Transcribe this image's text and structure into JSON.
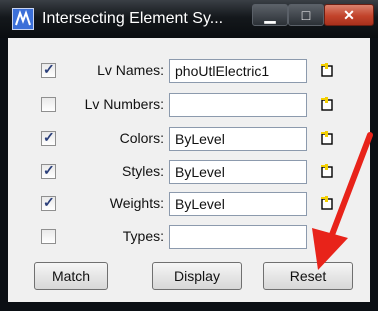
{
  "window": {
    "title": "Intersecting Element Sy...",
    "controls": {
      "minimize": "▁",
      "maximize": "□",
      "close": "✕"
    }
  },
  "rows": [
    {
      "label": "Lv Names:",
      "checked": true,
      "value": "phoUtlElectric1"
    },
    {
      "label": "Lv Numbers:",
      "checked": false,
      "value": ""
    },
    {
      "label": "Colors:",
      "checked": true,
      "value": "ByLevel"
    },
    {
      "label": "Styles:",
      "checked": true,
      "value": "ByLevel"
    },
    {
      "label": "Weights:",
      "checked": true,
      "value": "ByLevel"
    },
    {
      "label": "Types:",
      "checked": false,
      "value": ""
    }
  ],
  "check_mark": "✓",
  "buttons": {
    "match": "Match",
    "display": "Display",
    "reset": "Reset"
  },
  "colors": {
    "annotation_arrow": "#e8231a",
    "checkbox_mark": "#2b3f7a"
  }
}
